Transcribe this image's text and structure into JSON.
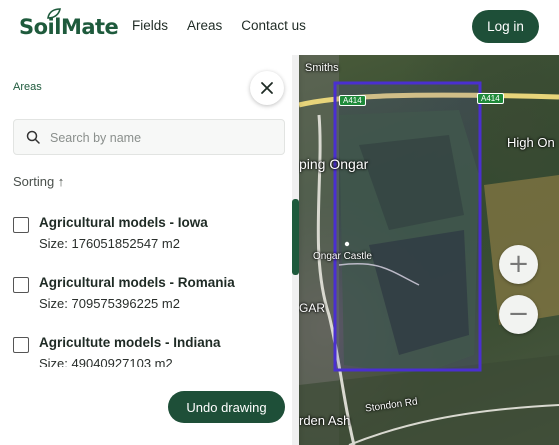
{
  "brand": {
    "name": "SoilMate",
    "color": "#1e5a3c"
  },
  "nav": {
    "items": [
      "Fields",
      "Areas",
      "Contact us"
    ]
  },
  "header": {
    "login_label": "Log in"
  },
  "panel": {
    "title": "Areas",
    "close_icon": "close-icon",
    "search": {
      "placeholder": "Search by name",
      "value": ""
    },
    "sorting_label": "Sorting ↑",
    "areas": [
      {
        "name": "Agricultural models - Iowa",
        "size": "Size: 176051852547 m2",
        "checked": false
      },
      {
        "name": "Agricultural models - Romania",
        "size": "Size: 709575396225 m2",
        "checked": false
      },
      {
        "name": "Agricultute models - Indiana",
        "size": "Size: 49040927103 m2",
        "checked": false
      }
    ],
    "undo_label": "Undo drawing"
  },
  "map": {
    "labels": {
      "smiths": "Smiths",
      "ongar": "ping Ongar",
      "high_ong": "High On",
      "castle": "Ongar Castle",
      "gar": "GAR",
      "arden": "rden Ash",
      "stondon": "Stondon Rd",
      "road_a414_left": "A414",
      "road_a414_right": "A414"
    },
    "zoom_in": "+",
    "zoom_out": "−",
    "selection_color": "#4a2fd0"
  }
}
